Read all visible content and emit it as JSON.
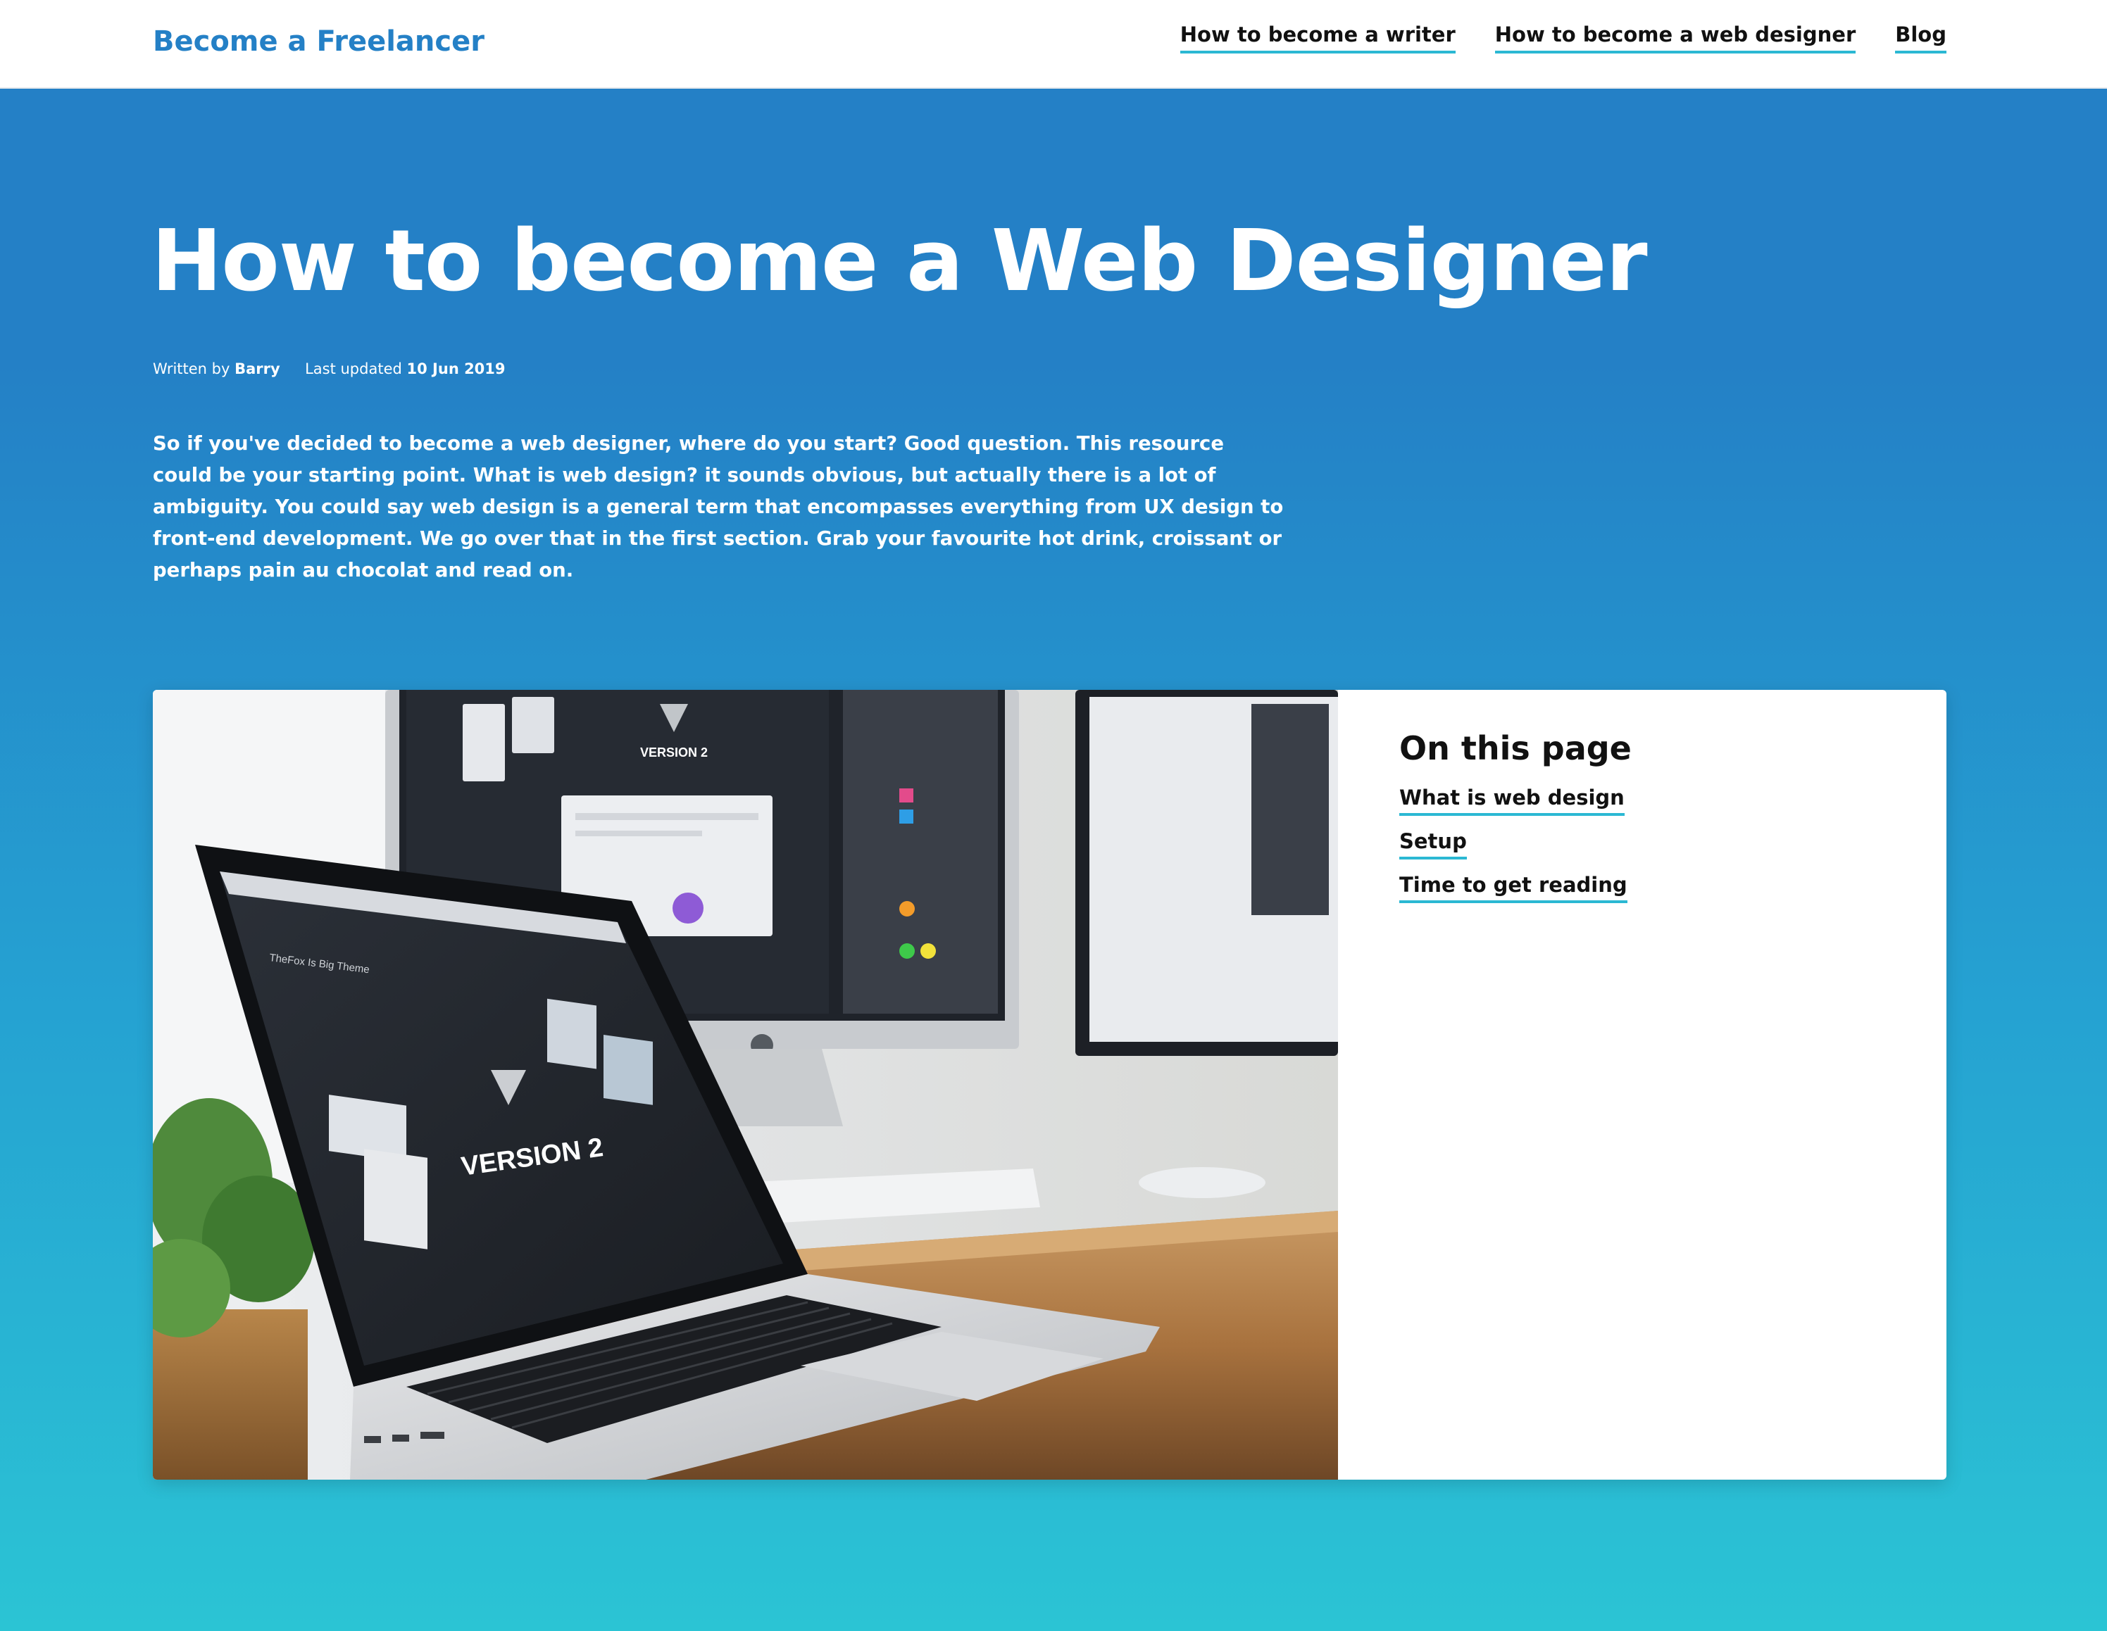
{
  "header": {
    "brand": "Become a Freelancer",
    "nav": [
      {
        "label": "How to become a writer"
      },
      {
        "label": "How to become a web designer"
      },
      {
        "label": "Blog"
      }
    ]
  },
  "hero": {
    "title": "How to become a Web Designer",
    "meta": {
      "written_by_label": "Written by",
      "author": "Barry",
      "updated_label": "Last updated",
      "date": "10 Jun 2019"
    },
    "intro": "So if you've decided to become a web designer, where do you start? Good question. This resource could be your starting point. What is web design? it sounds obvious, but actually there is a lot of ambiguity. You could say web design is a general term that encompasses everything from UX design to front-end development. We go over that in the first section. Grab your favourite hot drink, croissant or perhaps pain au chocolat and read on."
  },
  "feature": {
    "photo_screen_texts": {
      "laptop_title": "TheFox Is Big Theme",
      "laptop_version": "VERSION 2",
      "monitor_version": "VERSION 2"
    }
  },
  "toc": {
    "title": "On this page",
    "items": [
      {
        "label": "What is web design"
      },
      {
        "label": "Setup"
      },
      {
        "label": "Time to get reading"
      }
    ]
  },
  "colors": {
    "brand_blue": "#2480c6",
    "gradient_bottom": "#2bc4d4",
    "underline_accent": "#2bb8d3",
    "card_bg": "#ffffff"
  }
}
